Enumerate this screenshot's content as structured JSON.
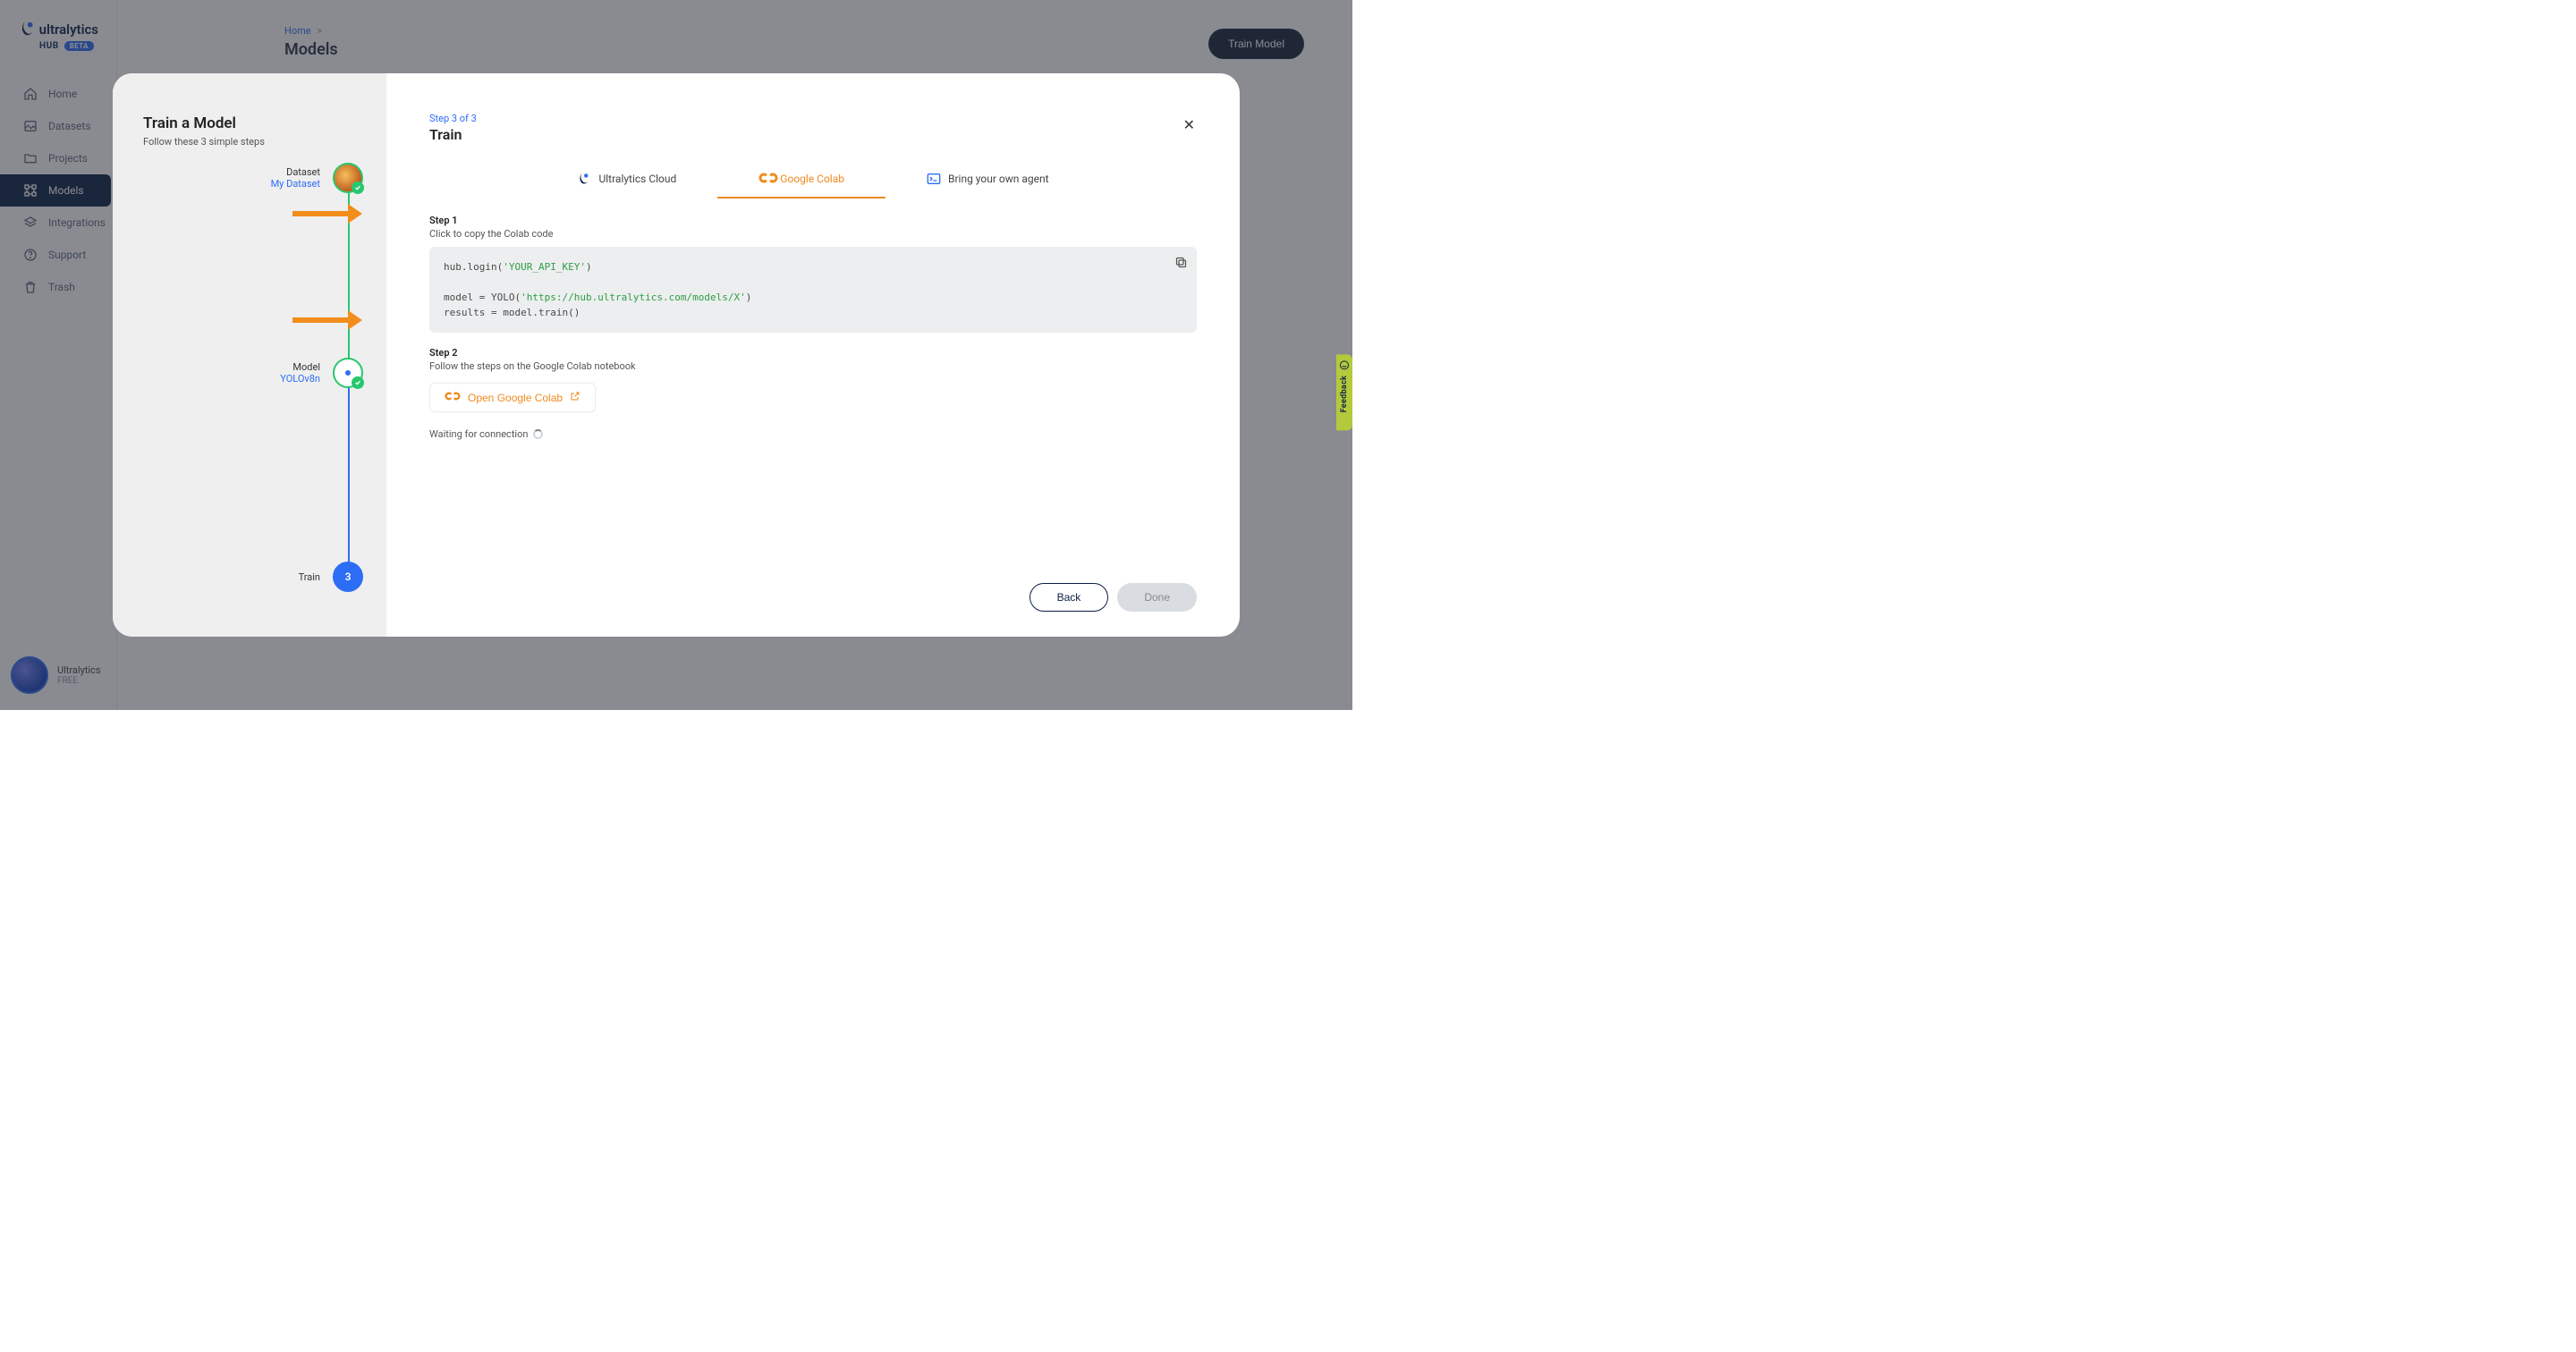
{
  "brand": {
    "name": "ultralytics",
    "hub": "HUB",
    "beta": "BETA"
  },
  "sidebar": {
    "items": [
      {
        "name": "home",
        "label": "Home"
      },
      {
        "name": "datasets",
        "label": "Datasets"
      },
      {
        "name": "projects",
        "label": "Projects"
      },
      {
        "name": "models",
        "label": "Models"
      },
      {
        "name": "integrations",
        "label": "Integrations"
      },
      {
        "name": "support",
        "label": "Support"
      },
      {
        "name": "trash",
        "label": "Trash"
      }
    ],
    "user": {
      "name": "Ultralytics",
      "plan": "FREE"
    }
  },
  "header": {
    "breadcrumb_home": "Home",
    "breadcrumb_sep": ">",
    "title": "Models",
    "train_button": "Train Model"
  },
  "modal": {
    "left": {
      "title": "Train a Model",
      "subtitle": "Follow these 3 simple steps",
      "steps": [
        {
          "label": "Dataset",
          "value": "My Dataset"
        },
        {
          "label": "Model",
          "value": "YOLOv8n"
        },
        {
          "label": "Train",
          "value": "3"
        }
      ]
    },
    "right": {
      "step_of": "Step 3 of 3",
      "title": "Train",
      "tabs": {
        "cloud": "Ultralytics Cloud",
        "colab": "Google Colab",
        "agent": "Bring your own agent"
      },
      "step1": {
        "label": "Step 1",
        "desc": "Click to copy the Colab code"
      },
      "code": {
        "l1_a": "hub.login(",
        "l1_b": "'YOUR_API_KEY'",
        "l1_c": ")",
        "l2_a": "model = YOLO(",
        "l2_b": "'https://hub.ultralytics.com/models/X'",
        "l2_c": ")",
        "l3": "results = model.train()"
      },
      "step2": {
        "label": "Step 2",
        "desc": "Follow the steps on the Google Colab notebook"
      },
      "open_colab": "Open Google Colab",
      "waiting": "Waiting for connection",
      "back": "Back",
      "done": "Done"
    }
  },
  "feedback": {
    "label": "Feedback"
  }
}
